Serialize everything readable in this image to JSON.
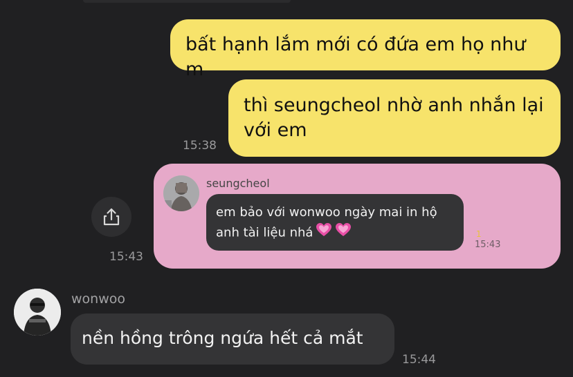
{
  "messages": {
    "msg1": "bất hạnh lắm mới có đứa em họ như m",
    "msg2": "thì seungcheol nhờ anh nhắn lại với em",
    "msg2_time": "15:38",
    "forward_time": "15:43",
    "incoming": {
      "sender": "wonwoo",
      "text": "nền hồng trông ngứa hết cả mắt",
      "time": "15:44"
    }
  },
  "forwarded": {
    "sender": "seungcheol",
    "text": "em bảo với wonwoo ngày mai in hộ anh tài liệu nhá",
    "read_count": "1",
    "time": "15:43",
    "emoji": "heart-icon"
  },
  "colors": {
    "background": "#202022",
    "outgoing_bubble": "#f7e36b",
    "forward_card": "#e6a9c9",
    "incoming_bubble": "#343436"
  },
  "icons": {
    "share": "share-icon"
  }
}
